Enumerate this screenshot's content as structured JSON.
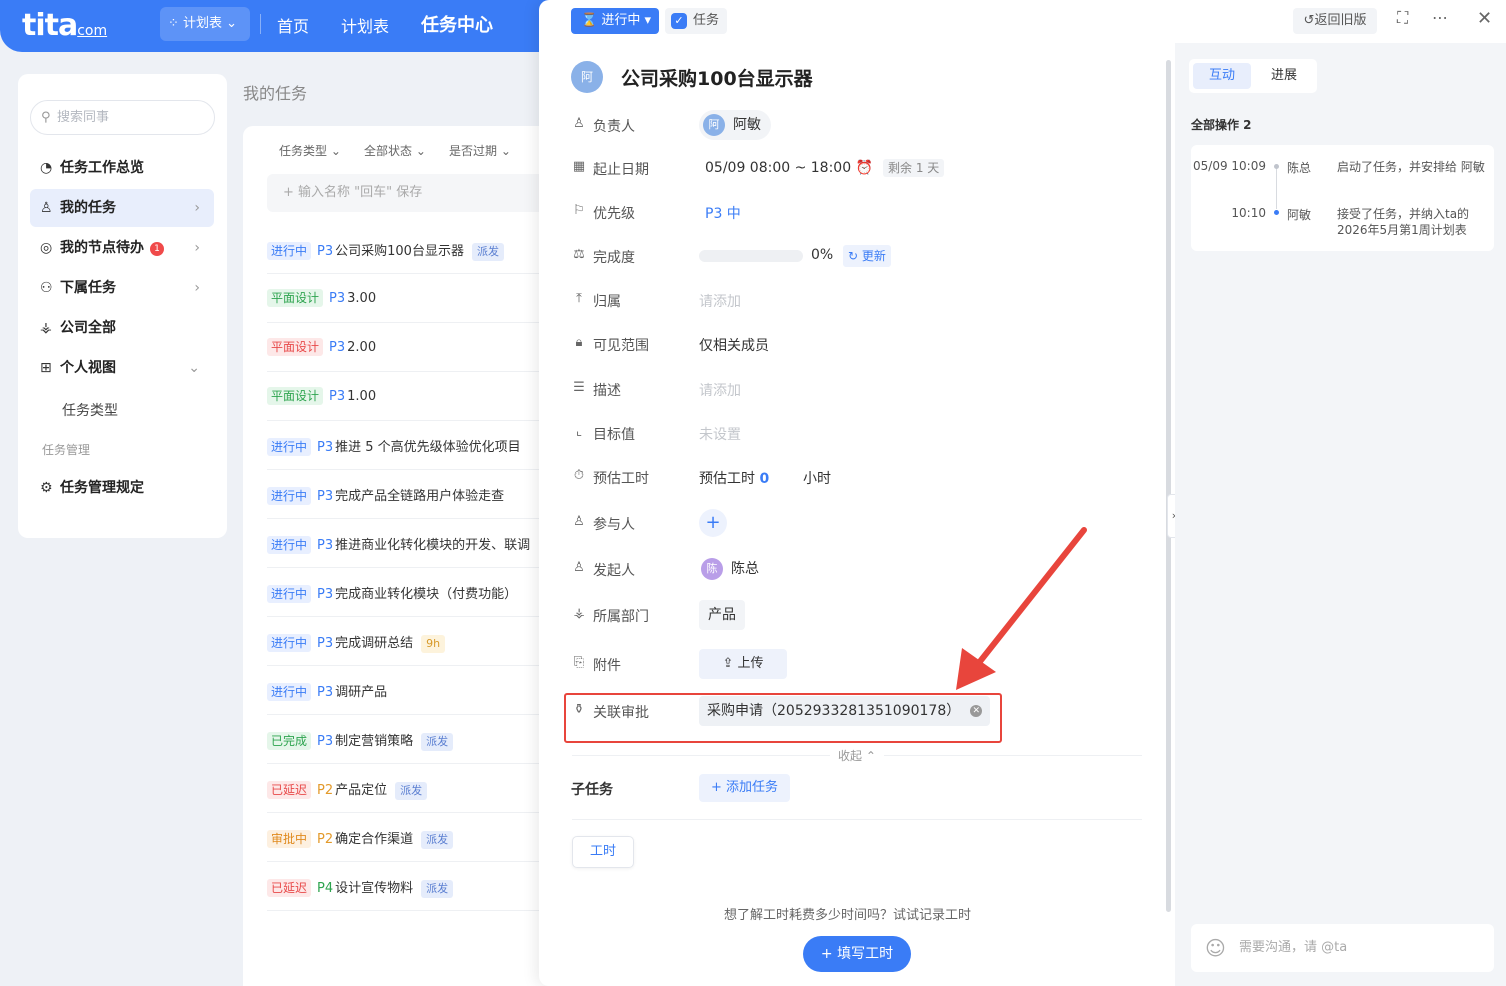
{
  "nav": {
    "logo": "tita",
    "logo_suffix": "com",
    "plan_pill": "计划表",
    "links": [
      "首页",
      "计划表",
      "任务中心"
    ]
  },
  "sidebar": {
    "search_placeholder": "搜索同事",
    "items": [
      {
        "label": "任务工作总览",
        "icon": "clock-check-icon"
      },
      {
        "label": "我的任务",
        "icon": "user-icon"
      },
      {
        "label": "我的节点待办",
        "icon": "check-circle-icon",
        "badge": "1"
      },
      {
        "label": "下属任务",
        "icon": "org-icon"
      },
      {
        "label": "公司全部",
        "icon": "hierarchy-icon"
      },
      {
        "label": "个人视图",
        "icon": "grid-icon"
      }
    ],
    "sub_item": "任务类型",
    "group_label": "任务管理",
    "rules_item": "任务管理规定"
  },
  "list": {
    "title": "我的任务",
    "filters": [
      "任务类型",
      "全部状态",
      "是否过期"
    ],
    "quick_add_placeholder": "输入名称 \"回车\" 保存",
    "rows": [
      {
        "status": "进行中",
        "tone": "blue",
        "pri": "P3",
        "name": "公司采购100台显示器",
        "chip": "派发"
      },
      {
        "status": "平面设计",
        "tone": "green",
        "pri": "P3",
        "name": "3.00",
        "chip": ""
      },
      {
        "status": "平面设计",
        "tone": "red",
        "pri": "P3",
        "name": "2.00",
        "chip": ""
      },
      {
        "status": "平面设计",
        "tone": "green",
        "pri": "P3",
        "name": "1.00",
        "chip": ""
      },
      {
        "status": "进行中",
        "tone": "blue",
        "pri": "P3",
        "name": "推进 5 个高优先级体验优化项目",
        "chip": ""
      },
      {
        "status": "进行中",
        "tone": "blue",
        "pri": "P3",
        "name": "完成产品全链路用户体验走查",
        "chip": ""
      },
      {
        "status": "进行中",
        "tone": "blue",
        "pri": "P3",
        "name": "推进商业化转化模块的开发、联调",
        "chip": ""
      },
      {
        "status": "进行中",
        "tone": "blue",
        "pri": "P3",
        "name": "完成商业转化模块（付费功能）",
        "chip": ""
      },
      {
        "status": "进行中",
        "tone": "blue",
        "pri": "P3",
        "name": "完成调研总结",
        "chip": "9h"
      },
      {
        "status": "进行中",
        "tone": "blue",
        "pri": "P3",
        "name": "调研产品",
        "chip": ""
      },
      {
        "status": "已完成",
        "tone": "green",
        "pri": "P3",
        "name": "制定营销策略",
        "chip": "派发"
      },
      {
        "status": "已延迟",
        "tone": "red",
        "pri": "P2",
        "name": "产品定位",
        "chip": "派发"
      },
      {
        "status": "审批中",
        "tone": "orange",
        "pri": "P2",
        "name": "确定合作渠道",
        "chip": "派发"
      },
      {
        "status": "已延迟",
        "tone": "red",
        "pri": "P4",
        "name": "设计宣传物料",
        "chip": "派发"
      }
    ]
  },
  "drawer": {
    "status": "进行中",
    "type": "任务",
    "back_label": "返回旧版",
    "title_avatar": "阿",
    "title": "公司采购100台显示器",
    "fields": {
      "owner_label": "负责人",
      "owner_avatar": "阿",
      "owner": "阿敏",
      "date_label": "起止日期",
      "date": "05/09 08:00 ~ 18:00",
      "remain": "剩余 1 天",
      "priority_label": "优先级",
      "priority": "P3 中",
      "progress_label": "完成度",
      "progress_pct": 0,
      "progress_text": "0%",
      "update_label": "更新",
      "belong_label": "归属",
      "belong_ph": "请添加",
      "visibility_label": "可见范围",
      "visibility": "仅相关成员",
      "desc_label": "描述",
      "desc_ph": "请添加",
      "target_label": "目标值",
      "target_ph": "未设置",
      "estimate_label": "预估工时",
      "estimate_prefix": "预估工时",
      "estimate_value": "0",
      "estimate_unit": "小时",
      "participants_label": "参与人",
      "initiator_label": "发起人",
      "initiator_avatar": "陈",
      "initiator": "陈总",
      "dept_label": "所属部门",
      "dept": "产品",
      "attach_label": "附件",
      "upload_label": "上传",
      "approval_label": "关联审批",
      "approval": "采购申请（2052933281351090178）"
    },
    "collapse_label": "收起",
    "subtask_label": "子任务",
    "add_task_label": "添加任务",
    "worktime_tab": "工时",
    "tip": "想了解工时耗费多少时间吗？试试记录工时",
    "fill_btn": "填写工时"
  },
  "activity": {
    "tabs": [
      "互动",
      "进展"
    ],
    "all_ops": "全部操作 2",
    "entries": [
      {
        "time": "05/09 10:09",
        "who": "陈总",
        "what": "启动了任务，并安排给 阿敏"
      },
      {
        "time": "10:10",
        "who": "阿敏",
        "what": "接受了任务，并纳入ta的 2026年5月第1周计划表"
      }
    ],
    "comment_placeholder": "需要沟通，请 @ta"
  },
  "colors": {
    "accent": "#3a7cf6",
    "highlight": "#e8453c"
  }
}
